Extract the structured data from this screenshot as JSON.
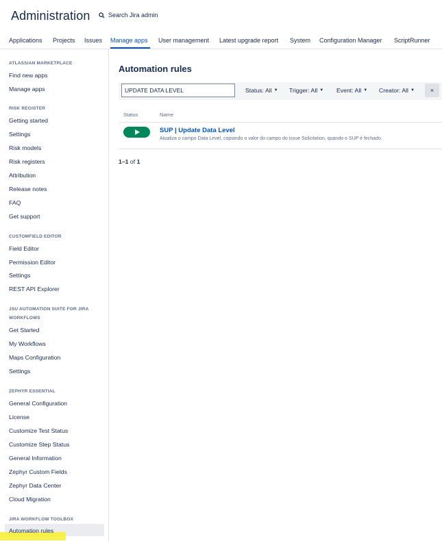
{
  "header": {
    "title": "Administration",
    "search_placeholder": "Search Jira admin"
  },
  "topnav": {
    "tabs": [
      {
        "label": "Applications",
        "active": false
      },
      {
        "label": "Projects",
        "active": false
      },
      {
        "label": "Issues",
        "active": false
      },
      {
        "label": "Manage apps",
        "active": true
      },
      {
        "label": "User management",
        "active": false
      },
      {
        "label": "Latest upgrade report",
        "active": false
      },
      {
        "label": "System",
        "active": false
      },
      {
        "label": "Configuration Manager",
        "active": false
      },
      {
        "label": "ScriptRunner",
        "active": false
      }
    ]
  },
  "sidebar": {
    "sections": [
      {
        "title": "ATLASSIAN MARKETPLACE",
        "items": [
          "Find new apps",
          "Manage apps"
        ]
      },
      {
        "title": "RISK REGISTER",
        "items": [
          "Getting started",
          "Settings",
          "Risk models",
          "Risk registers",
          "Attribution",
          "Release notes",
          "FAQ",
          "Get support"
        ]
      },
      {
        "title": "CUSTOMFIELD EDITOR",
        "items": [
          "Field Editor",
          "Permission Editor",
          "Settings",
          "REST API Explorer"
        ]
      },
      {
        "title": "JSU AUTOMATION SUITE FOR JIRA WORKFLOWS",
        "items": [
          "Get Started",
          "My Workflows",
          "Maps Configuration",
          "Settings"
        ]
      },
      {
        "title": "ZEPHYR ESSENTIAL",
        "items": [
          "General Configuration",
          "License",
          "Customize Test Status",
          "Customize Step Status",
          "General Information",
          "Zephyr Custom Fields",
          "Zephyr Data Center",
          "Cloud Migration"
        ]
      },
      {
        "title": "JIRA WORKFLOW TOOLBOX",
        "items": [
          "Automation rules"
        ]
      }
    ],
    "active_item": "Automation rules"
  },
  "main": {
    "title": "Automation rules",
    "filter": {
      "search_value": "UPDATE DATA LEVEL",
      "status": "Status: All",
      "trigger": "Trigger: All",
      "event": "Event: All",
      "creator": "Creator: All",
      "clear_glyph": "×"
    },
    "table": {
      "columns": [
        "Status",
        "Name"
      ],
      "rows": [
        {
          "enabled": true,
          "name": "SUP | Update Data Level",
          "description": "Atualiza o campo Data Level, copiando o valor do campo do issue Solicitation, quando o SUP é fechado."
        }
      ]
    },
    "pager": {
      "range": "1–1",
      "of_label": "of",
      "total": "1"
    }
  },
  "colors": {
    "accent": "#0052cc",
    "toggle_on": "#00875a",
    "highlight": "#f6f034"
  }
}
